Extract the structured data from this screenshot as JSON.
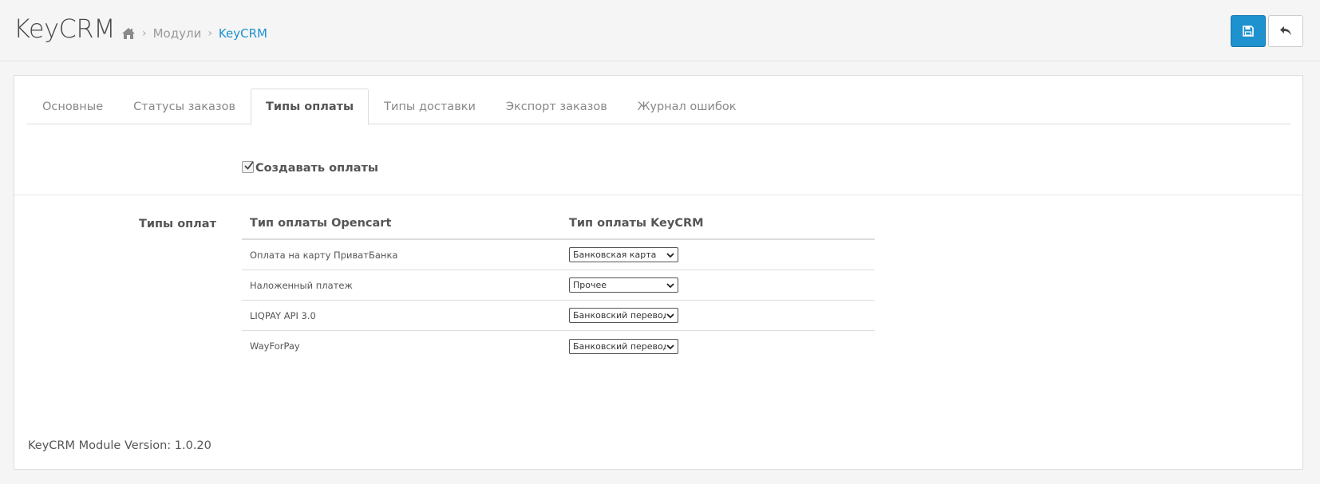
{
  "header": {
    "title": "KeyCRM",
    "breadcrumb": [
      {
        "label": "Модули"
      },
      {
        "label": "KeyCRM"
      }
    ]
  },
  "tabs": [
    {
      "label": "Основные"
    },
    {
      "label": "Статусы заказов"
    },
    {
      "label": "Типы оплаты"
    },
    {
      "label": "Типы доставки"
    },
    {
      "label": "Экспорт заказов"
    },
    {
      "label": "Журнал ошибок"
    }
  ],
  "create_payments": {
    "label": "Создавать оплаты",
    "checked": true
  },
  "payment_types": {
    "section_label": "Типы оплат",
    "columns": [
      "Тип оплаты Opencart",
      "Тип оплаты KeyCRM"
    ],
    "rows": [
      {
        "opencart": "Оплата на карту ПриватБанка",
        "keycrm": "Банковская карта"
      },
      {
        "opencart": "Наложенный платеж",
        "keycrm": "Прочее"
      },
      {
        "opencart": "LIQPAY API 3.0",
        "keycrm": "Банковский перевод"
      },
      {
        "opencart": "WayForPay",
        "keycrm": "Банковский перевод"
      }
    ]
  },
  "footer": {
    "version": "KeyCRM Module Version: 1.0.20"
  },
  "colors": {
    "primary": "#1e91cf",
    "link": "#1e91cf"
  }
}
